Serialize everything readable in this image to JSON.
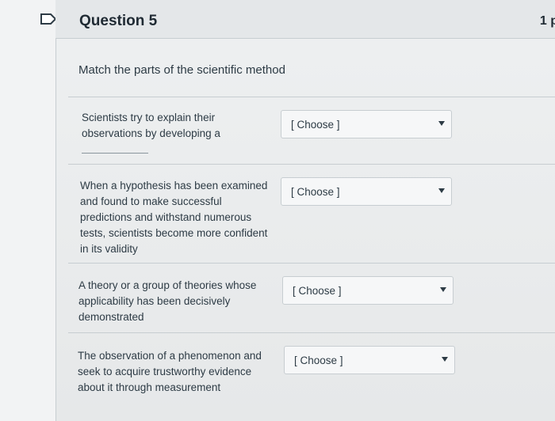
{
  "header": {
    "title": "Question 5",
    "points": "1 p"
  },
  "prompt": "Match the parts of the scientific method",
  "items": [
    {
      "lines": [
        "Scientists try to explain their",
        "observations by developing a"
      ],
      "select": "[ Choose ]"
    },
    {
      "lines": [
        "When a hypothesis has been examined",
        "and found to make successful",
        "predictions and withstand numerous",
        "tests, scientists become more confident",
        "in its validity"
      ],
      "select": "[ Choose ]"
    },
    {
      "lines": [
        "A theory or a group of theories whose",
        "applicability has been decisively",
        "demonstrated"
      ],
      "select": "[ Choose ]"
    },
    {
      "lines": [
        "The observation of a phenomenon and",
        "seek to acquire trustworthy evidence",
        "about it through measurement"
      ],
      "select": "[ Choose ]"
    }
  ],
  "colors": {
    "text": "#2d3b45",
    "border": "#c7cdd1",
    "background": "#e9ebec"
  },
  "icons": {
    "flag": "flag-outline-icon",
    "dropdown": "chevron-down-icon"
  }
}
